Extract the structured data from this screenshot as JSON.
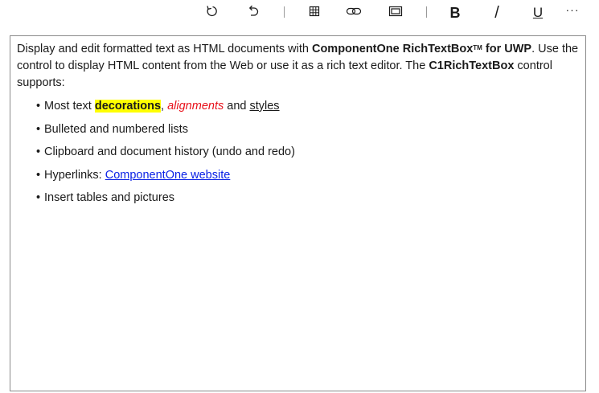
{
  "toolbar": {
    "redo_icon": "redo-icon",
    "undo_icon": "undo-icon",
    "table_icon": "table-icon",
    "hyperlink_icon": "hyperlink-icon",
    "picture_icon": "picture-icon",
    "bold_label": "B",
    "italic_label": "/",
    "underline_label": "U",
    "more_label": "···"
  },
  "editor": {
    "intro": {
      "part1": "Display and edit formatted text as HTML documents with ",
      "product_name": "ComponentOne RichTextBox",
      "trademark": "TM",
      "product_suffix": " for UWP",
      "part2": ". Use the control to display HTML content from the Web or use it as a rich text editor. The ",
      "control_name": "C1RichTextBox",
      "part3": " control supports:"
    },
    "bullets": {
      "item1": {
        "prefix": "Most text ",
        "decorations": "decorations",
        "comma": ", ",
        "alignments": "alignments",
        "and": " and ",
        "styles": "styles"
      },
      "item2": "Bulleted and numbered lists",
      "item3": "Clipboard and document history (undo and redo)",
      "item4": {
        "prefix": "Hyperlinks: ",
        "link_text": "ComponentOne website"
      },
      "item5": "Insert tables and pictures"
    }
  },
  "colors": {
    "highlight": "#ffff00",
    "alignments_text": "#e8101a",
    "link": "#0b22e6",
    "border": "#8a8a8a"
  }
}
